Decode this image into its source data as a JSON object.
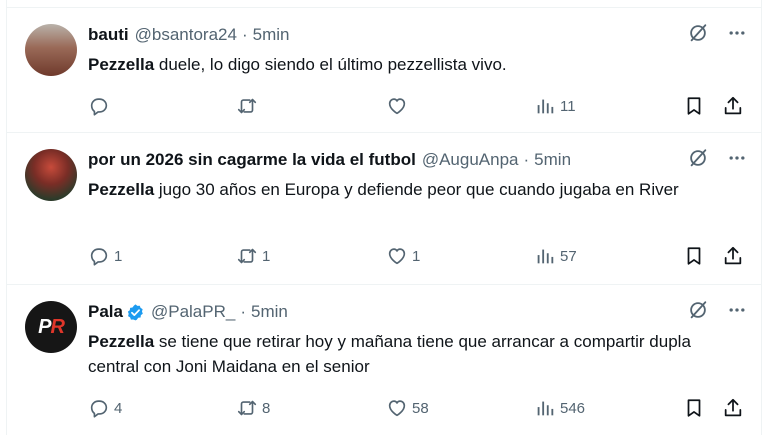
{
  "tweets": [
    {
      "name": "bauti",
      "handle": "@bsantora24",
      "sep": "·",
      "time": "5min",
      "verified": false,
      "text_bold": "Pezzella",
      "text_rest": " duele, lo digo siendo el último pezzellista vivo.",
      "replies": "",
      "retweets": "",
      "likes": "",
      "views": "11"
    },
    {
      "name": "por un 2026 sin cagarme la vida el futbol",
      "handle": "@AuguAnpa",
      "sep": "·",
      "time": "5min",
      "verified": false,
      "text_bold": "Pezzella",
      "text_rest": " jugo 30 años en Europa y defiende peor que cuando jugaba en River",
      "replies": "1",
      "retweets": "1",
      "likes": "1",
      "views": "57"
    },
    {
      "name": "Pala",
      "handle": "@PalaPR_",
      "sep": "·",
      "time": "5min",
      "verified": true,
      "avatar_text": "PR",
      "text_bold": "Pezzella",
      "text_rest": " se tiene que retirar hoy y mañana tiene que arrancar a compartir dupla central con Joni Maidana en el senior",
      "replies": "4",
      "retweets": "8",
      "likes": "58",
      "views": "546"
    }
  ],
  "icons": {
    "grok": "grok-icon",
    "more": "more-icon",
    "reply": "reply-icon",
    "retweet": "retweet-icon",
    "like": "like-icon",
    "views": "views-icon",
    "bookmark": "bookmark-icon",
    "share": "share-icon"
  },
  "colors": {
    "text": "#0f1419",
    "secondary": "#536471",
    "verified": "#1d9bf0",
    "border": "#eff3f4"
  }
}
